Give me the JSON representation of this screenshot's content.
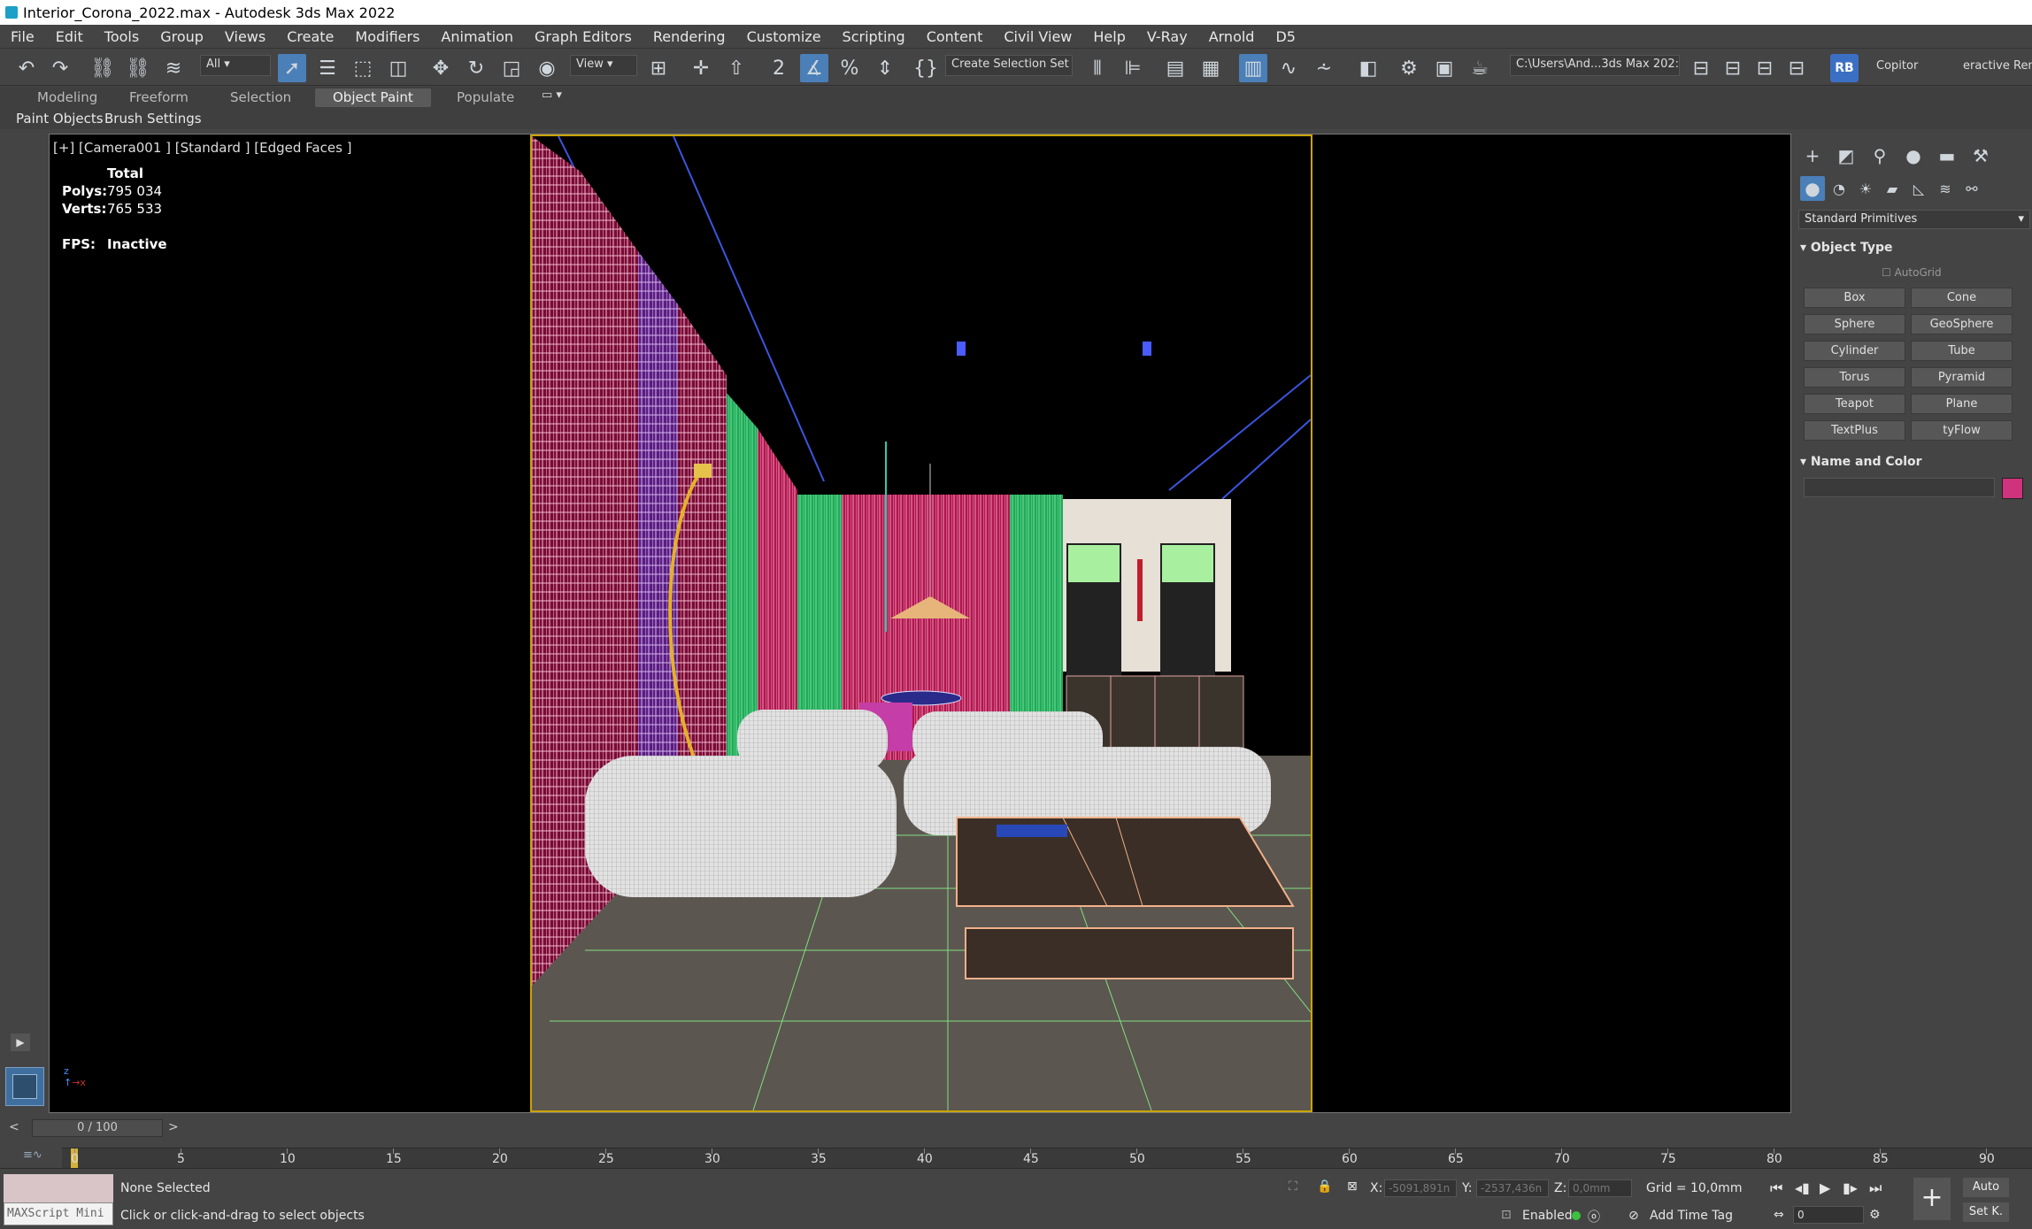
{
  "window": {
    "title": "Interior_Corona_2022.max - Autodesk 3ds Max 2022"
  },
  "menu": [
    "File",
    "Edit",
    "Tools",
    "Group",
    "Views",
    "Create",
    "Modifiers",
    "Animation",
    "Graph Editors",
    "Rendering",
    "Customize",
    "Scripting",
    "Content",
    "Civil View",
    "Help",
    "V-Ray",
    "Arnold",
    "D5"
  ],
  "toolbar": {
    "filter": "All",
    "refcoord": "View",
    "selection_set": "Create Selection Set",
    "project_path": "C:\\Users\\And...3ds Max 202:",
    "copitor": "Copitor",
    "interactive": "eractive Rend",
    "rb": "RB"
  },
  "ribbon": {
    "tabs": [
      "Modeling",
      "Freeform",
      "Selection",
      "Object Paint",
      "Populate"
    ],
    "active": "Object Paint",
    "sub": [
      "Paint Objects",
      "Brush Settings"
    ]
  },
  "viewport": {
    "label": "[+] [Camera001 ] [Standard ] [Edged Faces ]",
    "total_label": "Total",
    "polys_label": "Polys:",
    "polys": "795 034",
    "verts_label": "Verts:",
    "verts": "765 533",
    "fps_label": "FPS:",
    "fps": "Inactive"
  },
  "command_panel": {
    "category": "Standard Primitives",
    "object_type_title": "Object Type",
    "autogrid": "AutoGrid",
    "buttons": [
      "Box",
      "Cone",
      "Sphere",
      "GeoSphere",
      "Cylinder",
      "Tube",
      "Torus",
      "Pyramid",
      "Teapot",
      "Plane",
      "TextPlus",
      "tyFlow"
    ],
    "name_color_title": "Name and Color",
    "swatch": "#d0337d"
  },
  "timeline": {
    "frame": "0 / 100",
    "ticks": [
      "0",
      "5",
      "10",
      "15",
      "20",
      "25",
      "30",
      "35",
      "40",
      "45",
      "50",
      "55",
      "60",
      "65",
      "70",
      "75",
      "80",
      "85",
      "90"
    ]
  },
  "status": {
    "maxscript": "MAXScript Mini",
    "selected": "None Selected",
    "prompt": "Click or click-and-drag to select objects",
    "x_label": "X:",
    "x": "-5091,891n",
    "y_label": "Y:",
    "y": "-2537,436n",
    "z_label": "Z:",
    "z": "0,0mm",
    "grid": "Grid = 10,0mm",
    "enabled": "Enabled:",
    "add_time_tag": "Add Time Tag",
    "auto": "Auto",
    "setk": "Set K.",
    "frame_field": "0"
  },
  "colors": {
    "accent": "#4a7fb8",
    "frame": "#c9a400",
    "swatch": "#d0337d"
  }
}
